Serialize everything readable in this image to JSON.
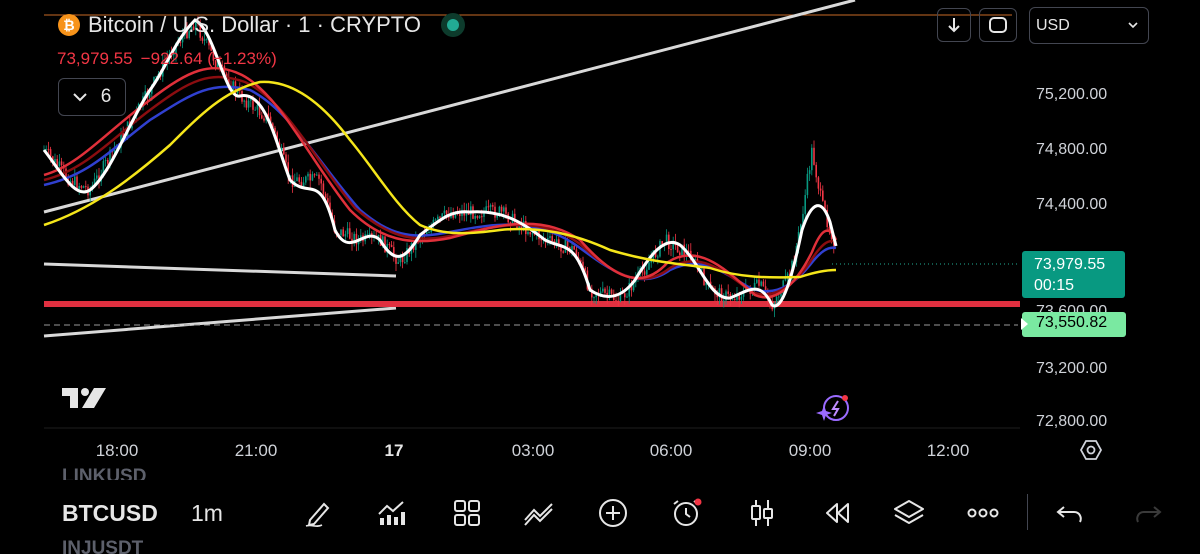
{
  "header": {
    "coin_badge": "₿",
    "title": "Bitcoin / U.S. Dollar · 1 · CRYPTO",
    "last_price": "73,979.55",
    "change": "−922.64 (−1.23%)",
    "indicator_count": "6",
    "currency": "USD"
  },
  "y_axis": {
    "labels": [
      "75,200.00",
      "74,800.00",
      "74,400.00",
      "73,200.00",
      "72,800.00"
    ],
    "ghost_label": "73,600.00"
  },
  "price_tag": {
    "price": "73,979.55",
    "countdown": "00:15"
  },
  "alert_tag": {
    "price": "73,550.82"
  },
  "x_axis": {
    "labels": [
      "18:00",
      "21:00",
      "17",
      "03:00",
      "06:00",
      "09:00",
      "12:00"
    ]
  },
  "bottom": {
    "symbol_above": "LINKUSD",
    "symbol": "BTCUSD",
    "symbol_below": "INJUSDT",
    "timeframe": "1m"
  },
  "colors": {
    "up": "#089981",
    "down": "#f23645",
    "accent": "#2962ff",
    "ma_white": "#ffffff",
    "ma_red": "#e0303a",
    "ma_darkred": "#8b0d10",
    "ma_blue": "#3040d0",
    "ma_yellow": "#f5e61a",
    "support": "#e03040"
  },
  "icons": [
    "bitcoin-icon",
    "chevron-down-icon",
    "scroll-down-icon",
    "sync-icon",
    "tradingview-logo",
    "ai-spark-icon",
    "settings-icon",
    "draw-icon",
    "indicators-icon",
    "layouts-icon",
    "trend-line-icon",
    "add-icon",
    "alert-clock-icon",
    "candles-icon",
    "replay-icon",
    "layers-icon",
    "more-icon",
    "undo-icon"
  ]
}
